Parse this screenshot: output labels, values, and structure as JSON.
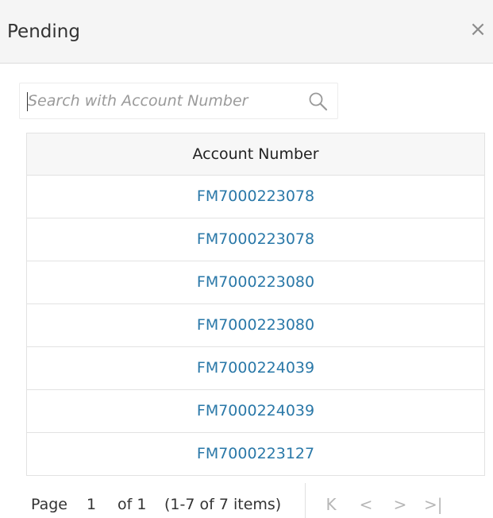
{
  "dialog": {
    "title": "Pending",
    "close_symbol": "×"
  },
  "search": {
    "placeholder": "Search with Account Number",
    "value": ""
  },
  "table": {
    "column_header": "Account Number",
    "rows": [
      "FM7000223078",
      "FM7000223078",
      "FM7000223080",
      "FM7000223080",
      "FM7000224039",
      "FM7000224039",
      "FM7000223127"
    ]
  },
  "pager": {
    "page_label": "Page",
    "current_page": "1",
    "of_label": "of 1",
    "items_label": "(1-7 of 7 items)",
    "first_icon": "first-page-icon",
    "prev_icon": "prev-page-icon",
    "next_icon": "next-page-icon",
    "last_icon": "last-page-icon",
    "first_glyph": "K",
    "prev_glyph": "<",
    "next_glyph": ">",
    "last_glyph": ">|"
  },
  "colors": {
    "link": "#2a78a8",
    "header_bg": "#f5f5f5",
    "disabled_nav": "#b6b6b6"
  }
}
